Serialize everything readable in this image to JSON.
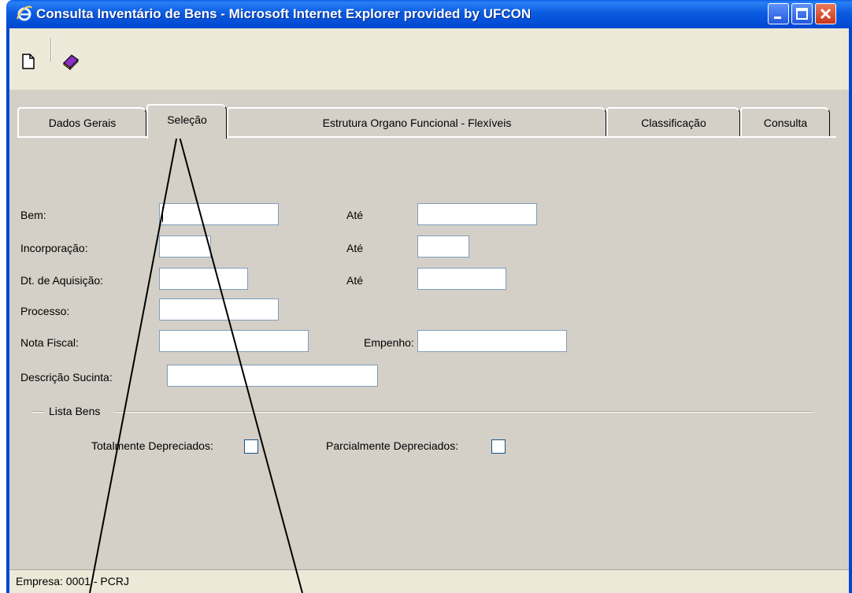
{
  "window": {
    "title": "Consulta Inventário de Bens - Microsoft Internet Explorer provided by UFCON",
    "controls": [
      "minimize",
      "maximize",
      "close"
    ]
  },
  "toolbar": {
    "icons": [
      "new-document-icon",
      "help-book-icon"
    ]
  },
  "tabs": [
    {
      "label": "Dados Gerais",
      "active": false
    },
    {
      "label": "Seleção",
      "active": true
    },
    {
      "label": "Estrutura Organo Funcional - Flexíveis",
      "active": false
    },
    {
      "label": "Classificação",
      "active": false
    },
    {
      "label": "Consulta",
      "active": false
    }
  ],
  "form": {
    "bem_label": "Bem:",
    "incorporacao_label": "Incorporação:",
    "dt_aquisicao_label": "Dt. de Aquisição:",
    "processo_label": "Processo:",
    "nota_fiscal_label": "Nota Fiscal:",
    "descricao_label": "Descrição Sucinta:",
    "ate_label": "Até",
    "empenho_label": "Empenho:",
    "values": {
      "bem": "",
      "bem_ate": "",
      "incorporacao": "",
      "incorporacao_ate": "",
      "dt_aquisicao": "",
      "dt_aquisicao_ate": "",
      "processo": "",
      "nota_fiscal": "",
      "empenho": "",
      "descricao": ""
    }
  },
  "lista_bens": {
    "legend": "Lista Bens",
    "totalmente_label": "Totalmente Depreciados:",
    "parcialmente_label": "Parcialmente Depreciados:",
    "totalmente_checked": false,
    "parcialmente_checked": false
  },
  "status": {
    "text": "Empresa: 0001 - PCRJ"
  },
  "colors": {
    "titlebar": "#0047d1",
    "form_bg": "#d4d0c8",
    "input_border": "#7f9db9"
  }
}
